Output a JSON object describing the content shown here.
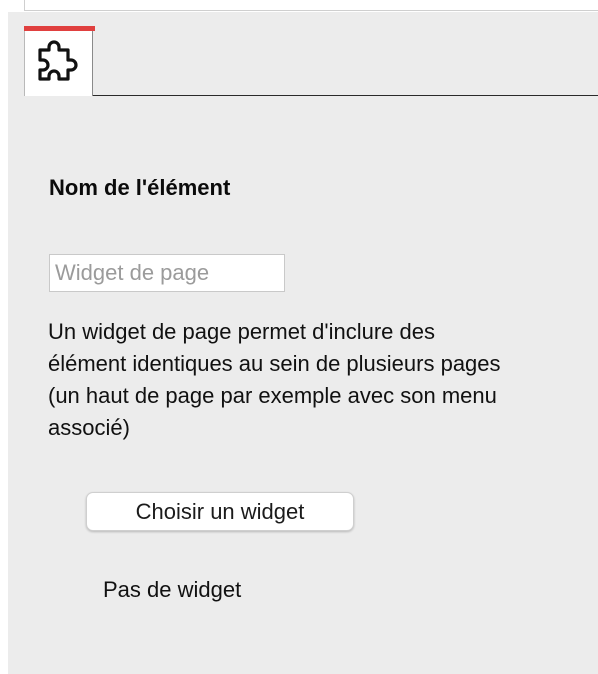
{
  "element_name": {
    "label": "Nom de l'élément",
    "placeholder": "Widget de page",
    "value": ""
  },
  "description_lines": [
    "Un widget de page permet d'inclure des",
    "élément identiques au sein de plusieurs pages",
    "(un haut de page par exemple avec son menu",
    "associé)"
  ],
  "choose_button_label": "Choisir un widget",
  "widget_status": "Pas de widget",
  "tabs": [
    {
      "icon": "puzzle-icon",
      "active": true
    }
  ],
  "colors": {
    "tab_accent": "#e0403f",
    "panel_background": "#ececec"
  }
}
